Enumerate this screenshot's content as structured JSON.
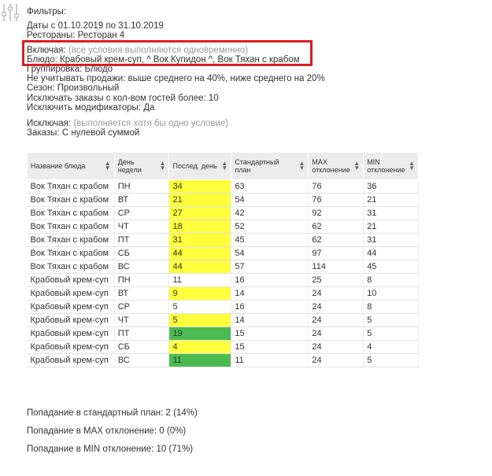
{
  "filters": {
    "label": "Фильтры:",
    "dates": "Даты с 01.10.2019 по 31.10.2019",
    "restaurants": "Рестораны: Ресторан 4",
    "include_label": "Включая:",
    "include_note": "(все условия выполняются одновременно)",
    "dish": "Блюдо: Крабовый крем-суп, ^ Вок Купидон ^, Вок Тяхан с крабом",
    "grouping": "Группировка: Блюдо",
    "ignore_sales": "Не учитывать продажи: выше среднего на 40%, ниже среднего на 20%",
    "season": "Сезон: Произвольный",
    "exclude_guests": "Исключать заказы с кол-вом гостей более: 10",
    "exclude_modifiers": "Исключить модификаторы: Да",
    "exclude_label": "Исключая:",
    "exclude_note": "(выполняется хотя бы одно условие)",
    "orders": "Заказы: С нулевой суммой"
  },
  "table": {
    "headers": {
      "name": "Название блюда",
      "day": "День недели",
      "last_day": "Послед. день",
      "plan": "Стандартный план",
      "max_dev_1": "MAX",
      "max_dev_2": "отклонение",
      "min_dev_1": "MIN",
      "min_dev_2": "отклонение"
    },
    "colors": {
      "yellow": "#ffff3c",
      "green": "#4cbc52"
    },
    "rows": [
      {
        "name": "Вок Тяхан с крабом",
        "day": "ПН",
        "last": "34",
        "plan": "63",
        "max": "76",
        "min": "36",
        "hl": "yellow"
      },
      {
        "name": "Вок Тяхан с крабом",
        "day": "ВТ",
        "last": "21",
        "plan": "54",
        "max": "76",
        "min": "21",
        "hl": "yellow"
      },
      {
        "name": "Вок Тяхан с крабом",
        "day": "СР",
        "last": "27",
        "plan": "42",
        "max": "92",
        "min": "31",
        "hl": "yellow"
      },
      {
        "name": "Вок Тяхан с крабом",
        "day": "ЧТ",
        "last": "18",
        "plan": "52",
        "max": "62",
        "min": "21",
        "hl": "yellow"
      },
      {
        "name": "Вок Тяхан с крабом",
        "day": "ПТ",
        "last": "31",
        "plan": "45",
        "max": "62",
        "min": "31",
        "hl": "yellow"
      },
      {
        "name": "Вок Тяхан с крабом",
        "day": "СБ",
        "last": "44",
        "plan": "54",
        "max": "97",
        "min": "44",
        "hl": "yellow"
      },
      {
        "name": "Вок Тяхан с крабом",
        "day": "ВС",
        "last": "44",
        "plan": "57",
        "max": "114",
        "min": "45",
        "hl": "yellow"
      },
      {
        "name": "Крабовый крем-суп",
        "day": "ПН",
        "last": "11",
        "plan": "16",
        "max": "25",
        "min": "8",
        "hl": ""
      },
      {
        "name": "Крабовый крем-суп",
        "day": "ВТ",
        "last": "9",
        "plan": "14",
        "max": "24",
        "min": "10",
        "hl": "yellow"
      },
      {
        "name": "Крабовый крем-суп",
        "day": "СР",
        "last": "5",
        "plan": "16",
        "max": "24",
        "min": "8",
        "hl": ""
      },
      {
        "name": "Крабовый крем-суп",
        "day": "ЧТ",
        "last": "5",
        "plan": "14",
        "max": "24",
        "min": "5",
        "hl": "yellow"
      },
      {
        "name": "Крабовый крем-суп",
        "day": "ПТ",
        "last": "19",
        "plan": "15",
        "max": "24",
        "min": "5",
        "hl": "green"
      },
      {
        "name": "Крабовый крем-суп",
        "day": "СБ",
        "last": "4",
        "plan": "15",
        "max": "24",
        "min": "4",
        "hl": "yellow"
      },
      {
        "name": "Крабовый крем-суп",
        "day": "ВС",
        "last": "11",
        "plan": "11",
        "max": "24",
        "min": "5",
        "hl": "green"
      }
    ]
  },
  "stats": {
    "plan_hit": "Попадание в стандартный план: 2 (14%)",
    "max_hit": "Попадание в MAX отклонение: 0 (0%)",
    "min_hit": "Попадание в MIN отклонение: 10 (71%)"
  }
}
